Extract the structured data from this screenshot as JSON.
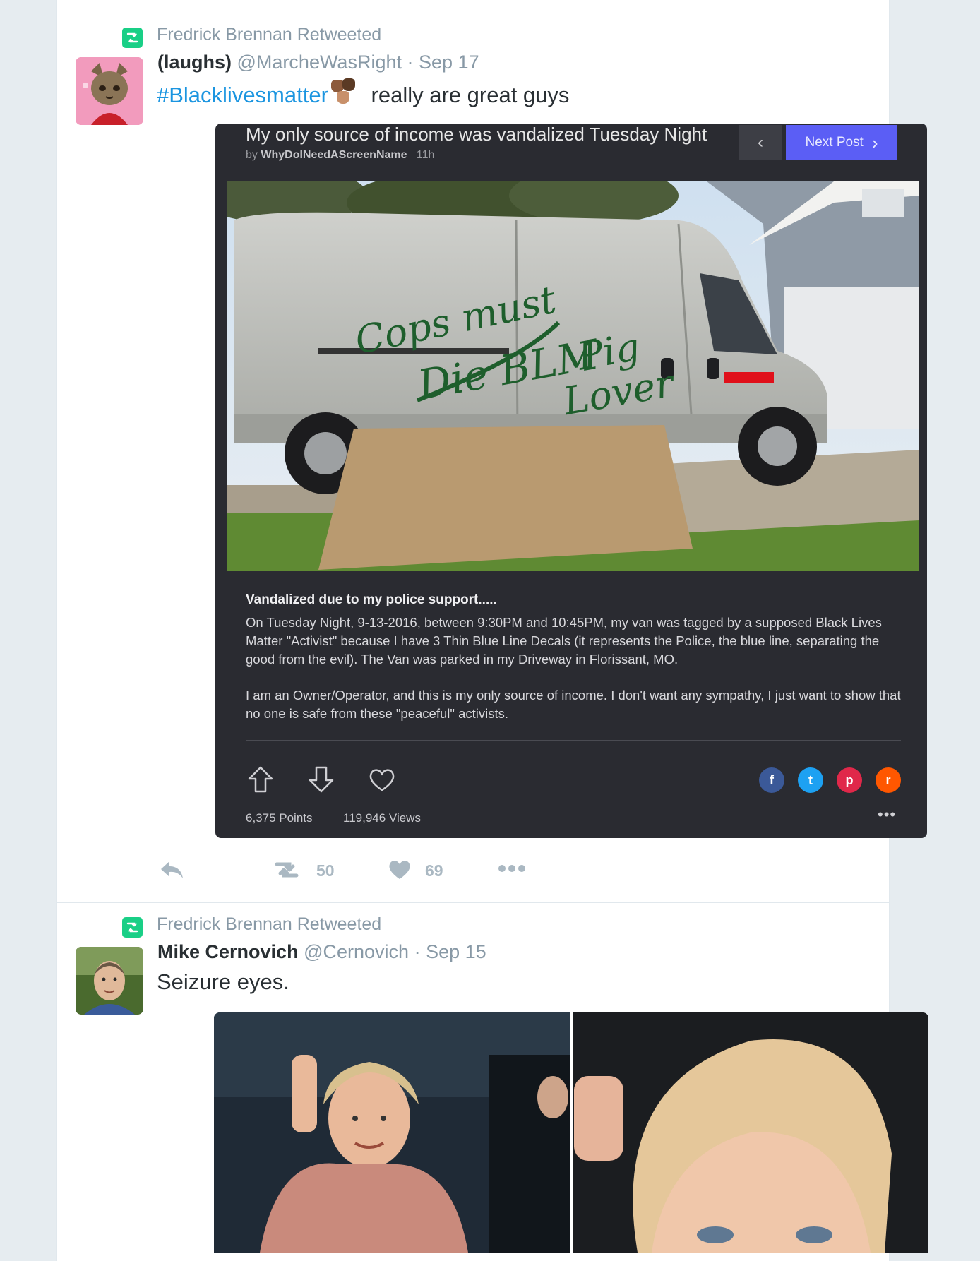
{
  "tweets": [
    {
      "context": "Fredrick Brennan Retweeted",
      "fullname": "(laughs)",
      "handle": "@MarcheWasRight",
      "separator": "·",
      "time": "Sep 17",
      "hashtag": "#Blacklivesmatter",
      "text": "really are great guys",
      "emoji": "raised-fists-emoji",
      "card": {
        "title": "My only source of income was vandalized Tuesday Night",
        "by_prefix": "by",
        "author": "WhyDoINeedAScreenName",
        "age": "11h",
        "prev_label": "‹",
        "next_label": "Next Post",
        "next_icon": "›",
        "photo_graffiti": [
          "Cops must Die BLM",
          "Pig Lover"
        ],
        "heading": "Vandalized due to my police support.....",
        "paragraph1": "On Tuesday Night, 9-13-2016, between 9:30PM and 10:45PM, my van was tagged by a supposed Black Lives Matter \"Activist\" because I have 3 Thin Blue Line Decals (it represents the Police, the blue line, separating the good from the evil). The Van was parked in my Driveway in Florissant, MO.",
        "paragraph2": "I am an Owner/Operator, and this is my only source of income. I don't want any sympathy, I just want to show that no one is safe from these \"peaceful\" activists.",
        "points": "6,375 Points",
        "views": "119,946 Views",
        "more": "•••",
        "social": [
          {
            "name": "facebook-icon",
            "glyph": "f",
            "color": "#3b5998"
          },
          {
            "name": "twitter-icon",
            "glyph": "t",
            "color": "#1da1f2"
          },
          {
            "name": "pinterest-icon",
            "glyph": "p",
            "color": "#e0284a"
          },
          {
            "name": "reddit-icon",
            "glyph": "r",
            "color": "#ff5700"
          }
        ]
      },
      "actions": {
        "retweets": "50",
        "likes": "69"
      }
    },
    {
      "context": "Fredrick Brennan Retweeted",
      "fullname": "Mike Cernovich",
      "handle": "@Cernovich",
      "separator": "·",
      "time": "Sep 15",
      "text": "Seizure eyes."
    }
  ],
  "colors": {
    "retweet_green": "#19cf86",
    "link_blue": "#1b95e0",
    "next_button": "#5b5ef5",
    "muted": "#8899a6",
    "action_gray": "#aab8c2"
  }
}
